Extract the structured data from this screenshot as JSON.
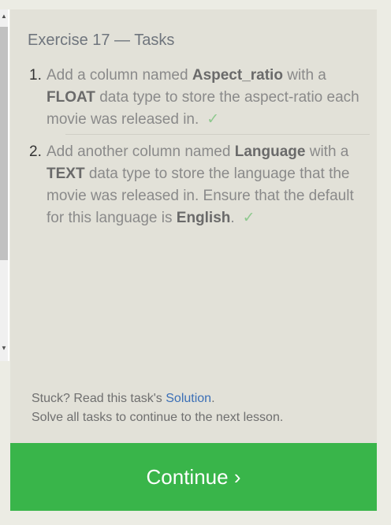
{
  "exercise": {
    "title": "Exercise 17 — Tasks"
  },
  "tasks": [
    {
      "number": "1.",
      "text_a": "Add a column named ",
      "bold_a": "Aspect_ratio",
      "text_b": " with a ",
      "bold_b": "FLOAT",
      "text_c": " data type to store the aspect-ratio each movie was released in.",
      "check": "✓"
    },
    {
      "number": "2.",
      "text_a": "Add another column named ",
      "bold_a": "Language",
      "text_b": " with a ",
      "bold_b": "TEXT",
      "text_c": " data type to store the language that the movie was released in. Ensure that the default for this language is ",
      "bold_c": "English",
      "text_d": ".",
      "check": "✓"
    }
  ],
  "footer": {
    "stuck_prefix": "Stuck? Read this task's ",
    "solution_link": "Solution",
    "stuck_suffix": ".",
    "instruction": "Solve all tasks to continue to the next lesson."
  },
  "continue_button": {
    "label": "Continue ›"
  },
  "colors": {
    "panel_bg": "#e2e1d8",
    "button_bg": "#39b54a",
    "link": "#3b6fb6",
    "check": "#8fc98f"
  }
}
